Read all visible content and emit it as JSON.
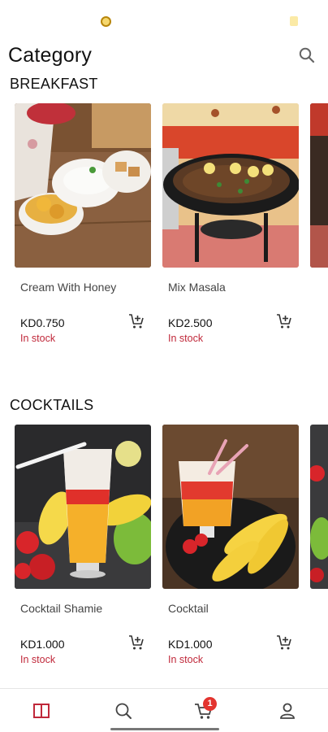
{
  "header": {
    "title": "Category"
  },
  "sections": [
    {
      "title": "BREAKFAST",
      "items": [
        {
          "name": "Cream With Honey",
          "price": "KD0.750",
          "stock": "In stock"
        },
        {
          "name": "Mix Masala",
          "price": "KD2.500",
          "stock": "In stock"
        }
      ]
    },
    {
      "title": "COCKTAILS",
      "items": [
        {
          "name": "Cocktail Shamie",
          "price": "KD1.000",
          "stock": "In stock"
        },
        {
          "name": "Cocktail",
          "price": "KD1.000",
          "stock": "In stock"
        }
      ]
    }
  ],
  "bottom_nav": {
    "cart_badge": "1"
  },
  "icons": {
    "search": "search-icon",
    "add_to_cart": "add-to-cart-icon",
    "categories": "categories-icon",
    "cart": "cart-icon",
    "profile": "profile-icon"
  },
  "colors": {
    "accent": "#c0283a",
    "badge": "#e3342f"
  }
}
